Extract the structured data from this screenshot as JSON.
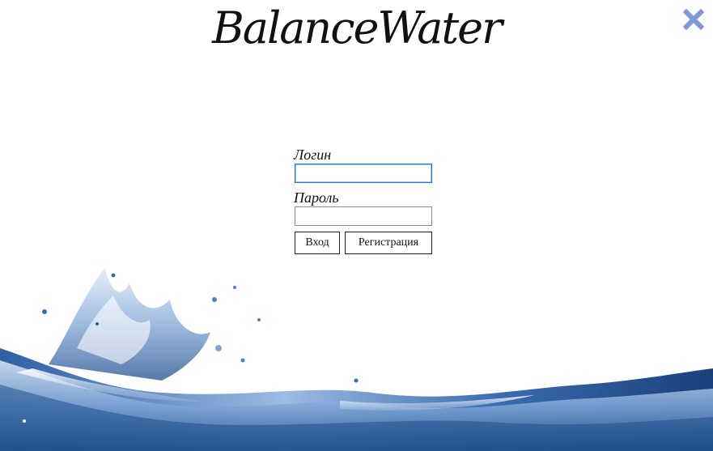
{
  "app": {
    "logo_text": "BalanceWater"
  },
  "login_form": {
    "login_label": "Логин",
    "login_value": "",
    "password_label": "Пароль",
    "password_value": "",
    "login_button": "Вход",
    "register_button": "Регистрация"
  },
  "icons": {
    "close": "close-icon",
    "water": "water-splash-icon"
  },
  "colors": {
    "close_icon": "#8197d6",
    "water_dark": "#1f4e8c",
    "water_light": "#cfe0f4",
    "focus_border": "#2a74c8"
  }
}
